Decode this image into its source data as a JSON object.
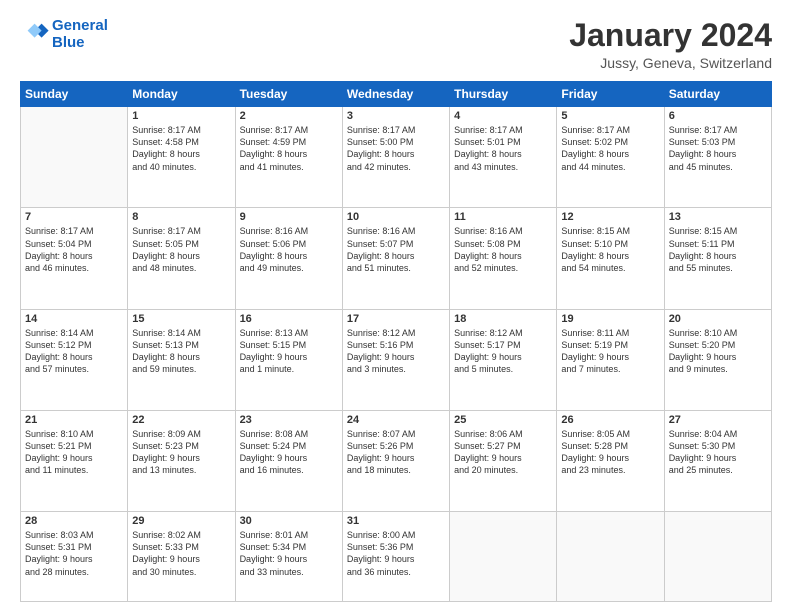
{
  "header": {
    "logo_line1": "General",
    "logo_line2": "Blue",
    "month": "January 2024",
    "location": "Jussy, Geneva, Switzerland"
  },
  "days_of_week": [
    "Sunday",
    "Monday",
    "Tuesday",
    "Wednesday",
    "Thursday",
    "Friday",
    "Saturday"
  ],
  "weeks": [
    [
      {
        "day": "",
        "info": ""
      },
      {
        "day": "1",
        "info": "Sunrise: 8:17 AM\nSunset: 4:58 PM\nDaylight: 8 hours\nand 40 minutes."
      },
      {
        "day": "2",
        "info": "Sunrise: 8:17 AM\nSunset: 4:59 PM\nDaylight: 8 hours\nand 41 minutes."
      },
      {
        "day": "3",
        "info": "Sunrise: 8:17 AM\nSunset: 5:00 PM\nDaylight: 8 hours\nand 42 minutes."
      },
      {
        "day": "4",
        "info": "Sunrise: 8:17 AM\nSunset: 5:01 PM\nDaylight: 8 hours\nand 43 minutes."
      },
      {
        "day": "5",
        "info": "Sunrise: 8:17 AM\nSunset: 5:02 PM\nDaylight: 8 hours\nand 44 minutes."
      },
      {
        "day": "6",
        "info": "Sunrise: 8:17 AM\nSunset: 5:03 PM\nDaylight: 8 hours\nand 45 minutes."
      }
    ],
    [
      {
        "day": "7",
        "info": "Sunrise: 8:17 AM\nSunset: 5:04 PM\nDaylight: 8 hours\nand 46 minutes."
      },
      {
        "day": "8",
        "info": "Sunrise: 8:17 AM\nSunset: 5:05 PM\nDaylight: 8 hours\nand 48 minutes."
      },
      {
        "day": "9",
        "info": "Sunrise: 8:16 AM\nSunset: 5:06 PM\nDaylight: 8 hours\nand 49 minutes."
      },
      {
        "day": "10",
        "info": "Sunrise: 8:16 AM\nSunset: 5:07 PM\nDaylight: 8 hours\nand 51 minutes."
      },
      {
        "day": "11",
        "info": "Sunrise: 8:16 AM\nSunset: 5:08 PM\nDaylight: 8 hours\nand 52 minutes."
      },
      {
        "day": "12",
        "info": "Sunrise: 8:15 AM\nSunset: 5:10 PM\nDaylight: 8 hours\nand 54 minutes."
      },
      {
        "day": "13",
        "info": "Sunrise: 8:15 AM\nSunset: 5:11 PM\nDaylight: 8 hours\nand 55 minutes."
      }
    ],
    [
      {
        "day": "14",
        "info": "Sunrise: 8:14 AM\nSunset: 5:12 PM\nDaylight: 8 hours\nand 57 minutes."
      },
      {
        "day": "15",
        "info": "Sunrise: 8:14 AM\nSunset: 5:13 PM\nDaylight: 8 hours\nand 59 minutes."
      },
      {
        "day": "16",
        "info": "Sunrise: 8:13 AM\nSunset: 5:15 PM\nDaylight: 9 hours\nand 1 minute."
      },
      {
        "day": "17",
        "info": "Sunrise: 8:12 AM\nSunset: 5:16 PM\nDaylight: 9 hours\nand 3 minutes."
      },
      {
        "day": "18",
        "info": "Sunrise: 8:12 AM\nSunset: 5:17 PM\nDaylight: 9 hours\nand 5 minutes."
      },
      {
        "day": "19",
        "info": "Sunrise: 8:11 AM\nSunset: 5:19 PM\nDaylight: 9 hours\nand 7 minutes."
      },
      {
        "day": "20",
        "info": "Sunrise: 8:10 AM\nSunset: 5:20 PM\nDaylight: 9 hours\nand 9 minutes."
      }
    ],
    [
      {
        "day": "21",
        "info": "Sunrise: 8:10 AM\nSunset: 5:21 PM\nDaylight: 9 hours\nand 11 minutes."
      },
      {
        "day": "22",
        "info": "Sunrise: 8:09 AM\nSunset: 5:23 PM\nDaylight: 9 hours\nand 13 minutes."
      },
      {
        "day": "23",
        "info": "Sunrise: 8:08 AM\nSunset: 5:24 PM\nDaylight: 9 hours\nand 16 minutes."
      },
      {
        "day": "24",
        "info": "Sunrise: 8:07 AM\nSunset: 5:26 PM\nDaylight: 9 hours\nand 18 minutes."
      },
      {
        "day": "25",
        "info": "Sunrise: 8:06 AM\nSunset: 5:27 PM\nDaylight: 9 hours\nand 20 minutes."
      },
      {
        "day": "26",
        "info": "Sunrise: 8:05 AM\nSunset: 5:28 PM\nDaylight: 9 hours\nand 23 minutes."
      },
      {
        "day": "27",
        "info": "Sunrise: 8:04 AM\nSunset: 5:30 PM\nDaylight: 9 hours\nand 25 minutes."
      }
    ],
    [
      {
        "day": "28",
        "info": "Sunrise: 8:03 AM\nSunset: 5:31 PM\nDaylight: 9 hours\nand 28 minutes."
      },
      {
        "day": "29",
        "info": "Sunrise: 8:02 AM\nSunset: 5:33 PM\nDaylight: 9 hours\nand 30 minutes."
      },
      {
        "day": "30",
        "info": "Sunrise: 8:01 AM\nSunset: 5:34 PM\nDaylight: 9 hours\nand 33 minutes."
      },
      {
        "day": "31",
        "info": "Sunrise: 8:00 AM\nSunset: 5:36 PM\nDaylight: 9 hours\nand 36 minutes."
      },
      {
        "day": "",
        "info": ""
      },
      {
        "day": "",
        "info": ""
      },
      {
        "day": "",
        "info": ""
      }
    ]
  ]
}
